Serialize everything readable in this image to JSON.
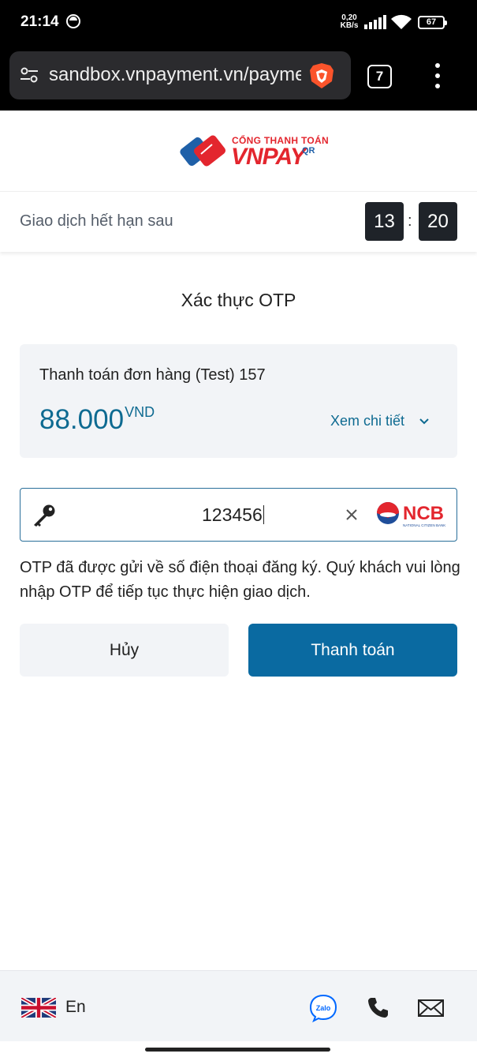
{
  "status_bar": {
    "time": "21:14",
    "net_speed_value": "0,20",
    "net_speed_unit": "KB/s",
    "battery": "67"
  },
  "browser": {
    "url": "sandbox.vnpayment.vn/payment",
    "tab_count": "7"
  },
  "logo": {
    "subtitle": "CỔNG THANH TOÁN",
    "brand": "VNPAY",
    "brand_suffix": "QR"
  },
  "timer": {
    "label": "Giao dịch hết hạn sau",
    "minutes": "13",
    "separator": ":",
    "seconds": "20"
  },
  "main": {
    "title": "Xác thực OTP",
    "order": {
      "name": "Thanh toán đơn hàng (Test) 157",
      "amount": "88.000",
      "currency": "VND",
      "detail_label": "Xem chi tiết"
    },
    "otp": {
      "value": "123456",
      "bank": "NCB",
      "bank_tagline": "NATIONAL CITIZEN BANK"
    },
    "note": "OTP đã được gửi về số điện thoại đăng ký. Quý khách vui lòng nhập OTP để tiếp tục thực hiện giao dịch.",
    "cancel_label": "Hủy",
    "pay_label": "Thanh toán"
  },
  "footer": {
    "language": "En",
    "zalo_label": "Zalo"
  },
  "colors": {
    "primary": "#0a6aa1",
    "brand_red": "#e3262e",
    "brand_blue": "#1f60a8"
  }
}
